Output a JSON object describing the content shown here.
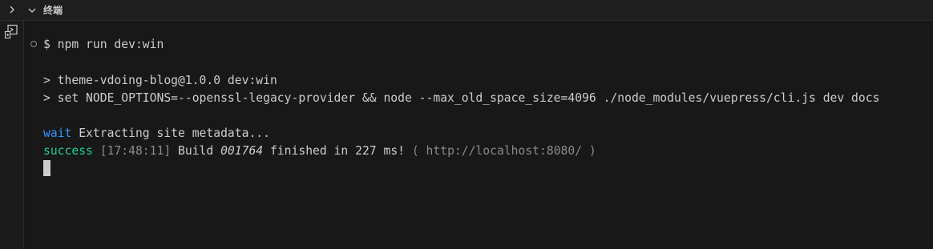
{
  "panel": {
    "title": "终端"
  },
  "terminal": {
    "command": "$ npm run dev:win",
    "script_line1": "> theme-vdoing-blog@1.0.0 dev:win",
    "script_line2": "> set NODE_OPTIONS=--openssl-legacy-provider && node --max_old_space_size=4096 ./node_modules/vuepress/cli.js dev docs",
    "wait": {
      "tag": "wait",
      "text": " Extracting site metadata..."
    },
    "success": {
      "tag": "success",
      "time": " [17:48:11]",
      "build_prefix": " Build ",
      "build_id": "001764",
      "build_suffix": " finished in 227 ms! ",
      "url_open": "( ",
      "url": "http://localhost:8080/",
      "url_close": " )"
    }
  },
  "colors": {
    "background": "#181818",
    "text": "#cccccc",
    "wait": "#3794ff",
    "success": "#23d18b",
    "muted": "#8a8a8a"
  },
  "icons": {
    "collapse": "chevron-right-icon",
    "expand": "chevron-down-icon",
    "terminal": "terminal-icon",
    "prompt": "circle-icon"
  }
}
